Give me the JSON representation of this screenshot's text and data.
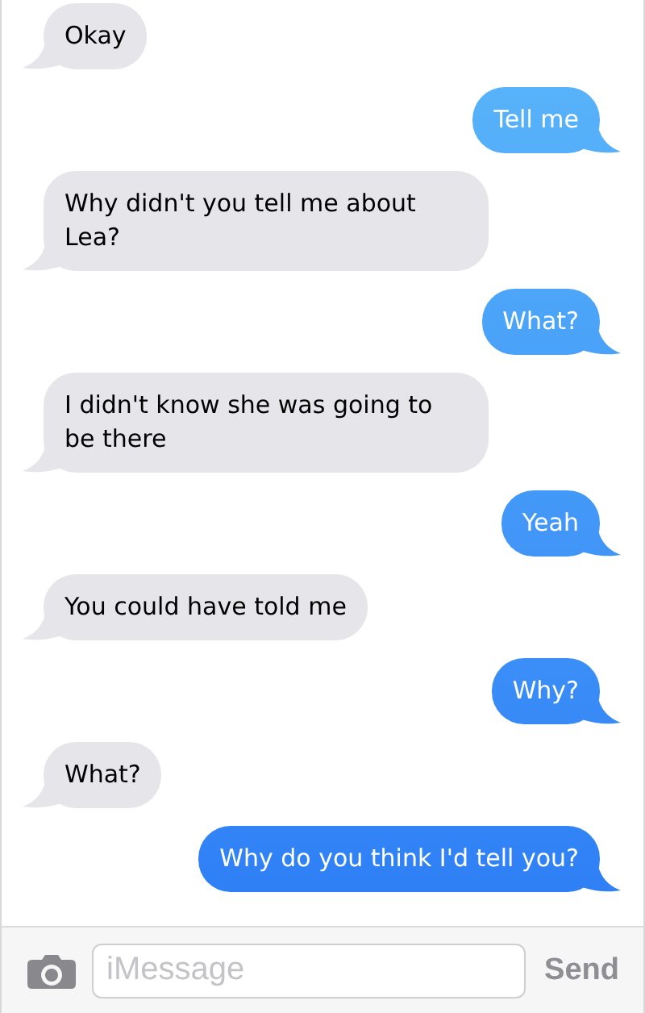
{
  "messages": [
    {
      "kind": "received",
      "text": "Okay"
    },
    {
      "kind": "sent",
      "text": "Tell me"
    },
    {
      "kind": "received",
      "text": "Why didn't you tell me about Lea?"
    },
    {
      "kind": "sent",
      "text": "What?"
    },
    {
      "kind": "received",
      "text": "I didn't know she was going to be there"
    },
    {
      "kind": "sent",
      "text": "Yeah"
    },
    {
      "kind": "received",
      "text": "You could have told me"
    },
    {
      "kind": "sent",
      "text": "Why?"
    },
    {
      "kind": "received",
      "text": "What?"
    },
    {
      "kind": "sent",
      "text": "Why do you think I'd tell you?"
    }
  ],
  "composer": {
    "placeholder": "iMessage",
    "send": {
      "label": "Send",
      "disabled": true
    }
  }
}
